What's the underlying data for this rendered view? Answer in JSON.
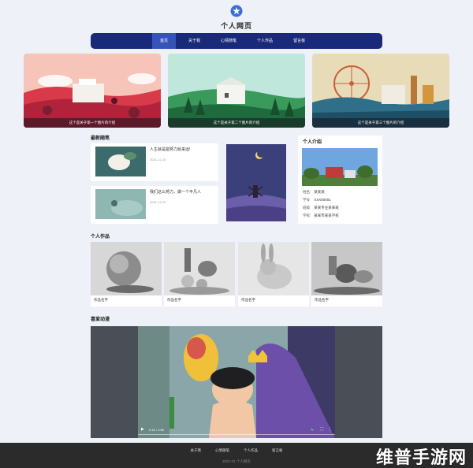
{
  "site": {
    "title": "个人网页",
    "logo_icon": "flower-icon"
  },
  "nav": {
    "items": [
      "首页",
      "关于我",
      "心情随笔",
      "个人作品",
      "留言板"
    ],
    "active_index": 0
  },
  "banners": [
    {
      "caption": "这个是关于第一个图片的介绍"
    },
    {
      "caption": "这个是关于第二个图片的介绍"
    },
    {
      "caption": "这个是关于第三个图片的介绍"
    }
  ],
  "posts": {
    "title": "最新随笔",
    "items": [
      {
        "title": "人生就是能努力就来运!",
        "date": "2021-12-10"
      },
      {
        "title": "我们这么努力，做一个平凡人",
        "date": "2021-12-10"
      }
    ]
  },
  "profile": {
    "title": "个人介绍",
    "rows": [
      {
        "label": "姓名:",
        "value": "某某某"
      },
      {
        "label": "学号:",
        "value": "XXX00001"
      },
      {
        "label": "班级:",
        "value": "某某专业某某班"
      },
      {
        "label": "学校:",
        "value": "某某市某某学校"
      }
    ]
  },
  "works": {
    "title": "个人作品",
    "items": [
      {
        "name": "作品名字"
      },
      {
        "name": "作品名字"
      },
      {
        "name": "作品名字"
      },
      {
        "name": "作品名字"
      }
    ]
  },
  "video": {
    "title": "喜爱动漫",
    "time": "0:13 / 1:06"
  },
  "footer": {
    "links": [
      "关于我",
      "心情随笔",
      "个人作品",
      "留言板"
    ],
    "copyright": "2021-01 个人网页"
  },
  "watermark": "维普手游网",
  "colors": {
    "nav_bg": "#1a2a7a",
    "nav_active": "#3654b8",
    "logo": "#3b6fd6"
  }
}
